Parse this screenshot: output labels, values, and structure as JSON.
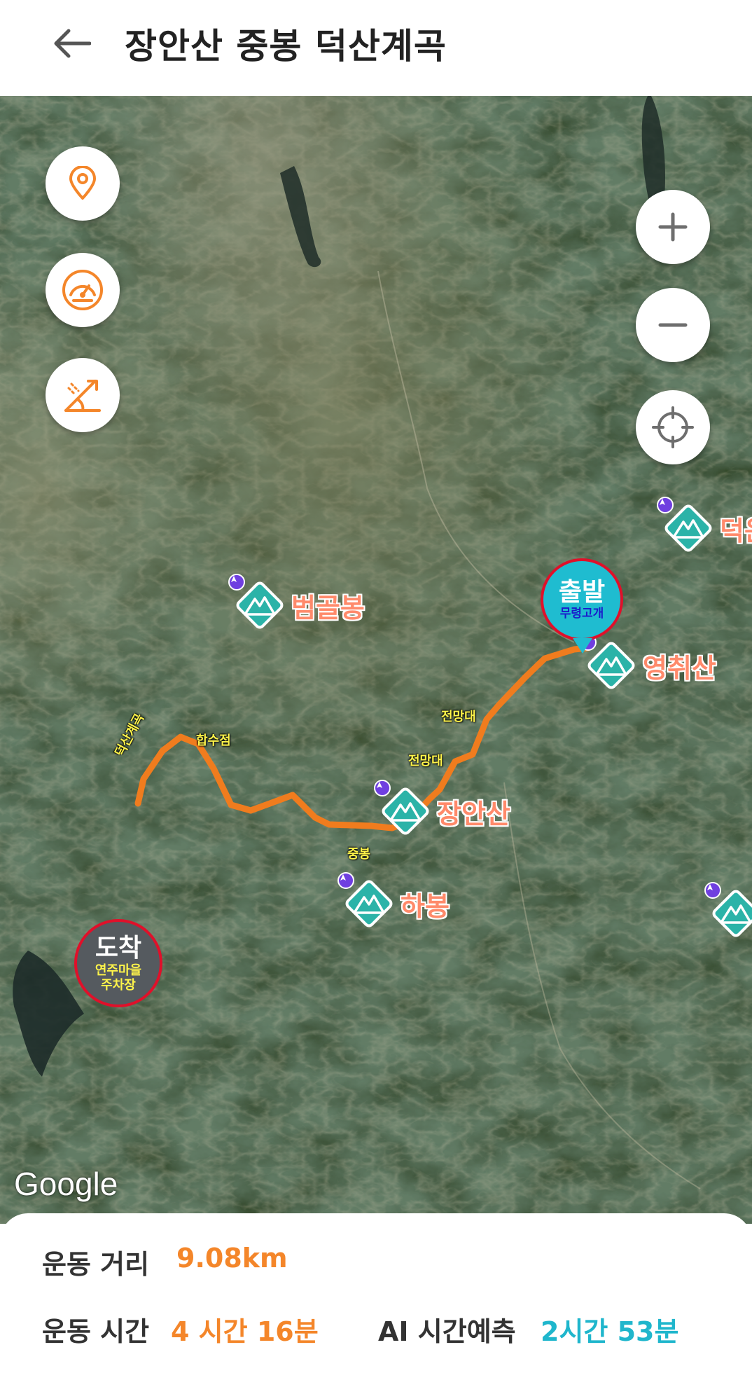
{
  "header": {
    "title": "장안산 중봉 덕산계곡"
  },
  "map": {
    "attribution": "Google",
    "controls": {
      "left": [
        "location-icon",
        "speedometer-icon",
        "altitude-icon"
      ],
      "right": [
        "zoom-in-icon",
        "zoom-out-icon",
        "crosshair-icon"
      ]
    },
    "peaks": [
      {
        "name": "범골봉"
      },
      {
        "name": "영취산"
      },
      {
        "name": "장안산"
      },
      {
        "name": "하봉"
      },
      {
        "name": "덕운"
      }
    ],
    "start": {
      "title": "출발",
      "subtitle": "무령고개"
    },
    "end": {
      "title": "도착",
      "subtitle_line1": "연주마을",
      "subtitle_line2": "주차장"
    },
    "route_labels": {
      "lookout1": "전망대",
      "lookout2": "전망대",
      "junction": "합수점",
      "valley": "덕산계곡",
      "jungbong": "중봉"
    },
    "colors": {
      "route": "#f07c1e",
      "peak_icon": "#2bb3a8",
      "start_marker": "#1fbcd0",
      "marker_border": "#e0102a"
    }
  },
  "stats": {
    "distance_label": "운동 거리",
    "distance_value": "9.08km",
    "time_label": "운동 시간",
    "time_value": "4 시간 16분",
    "ai_label": "AI 시간예측",
    "ai_value": "2시간 53분",
    "colors": {
      "orange": "#f4862a",
      "teal": "#1fb6cc"
    }
  }
}
